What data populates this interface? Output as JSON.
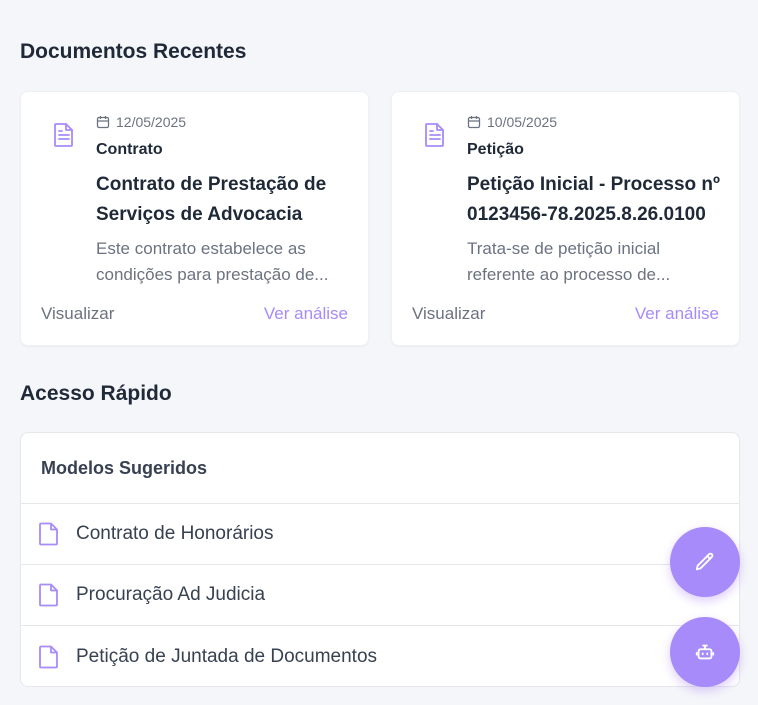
{
  "recent": {
    "title": "Documentos Recentes",
    "documents": [
      {
        "icon": "file-text-icon",
        "date": "12/05/2025",
        "type": "Contrato",
        "title": "Contrato de Prestação de Serviços de Advocacia",
        "description": "Este contrato estabelece as condições para prestação de...",
        "view_label": "Visualizar",
        "analysis_label": "Ver análise"
      },
      {
        "icon": "file-text-icon",
        "date": "10/05/2025",
        "type": "Petição",
        "title": "Petição Inicial - Processo nº 0123456-78.2025.8.26.0100",
        "description": "Trata-se de petição inicial referente ao processo de...",
        "view_label": "Visualizar",
        "analysis_label": "Ver análise"
      }
    ]
  },
  "quick_access": {
    "title": "Acesso Rápido",
    "panel_title": "Modelos Sugeridos",
    "models": [
      {
        "icon": "file-icon",
        "label": "Contrato de Honorários"
      },
      {
        "icon": "file-icon",
        "label": "Procuração Ad Judicia"
      },
      {
        "icon": "file-icon",
        "label": "Petição de Juntada de Documentos"
      }
    ]
  },
  "fabs": [
    {
      "icon": "pencil-icon"
    },
    {
      "icon": "bot-icon"
    }
  ],
  "colors": {
    "accent": "#a78bfa",
    "background": "#f5f6fa",
    "text": "#1f2937",
    "muted": "#6b7280"
  }
}
